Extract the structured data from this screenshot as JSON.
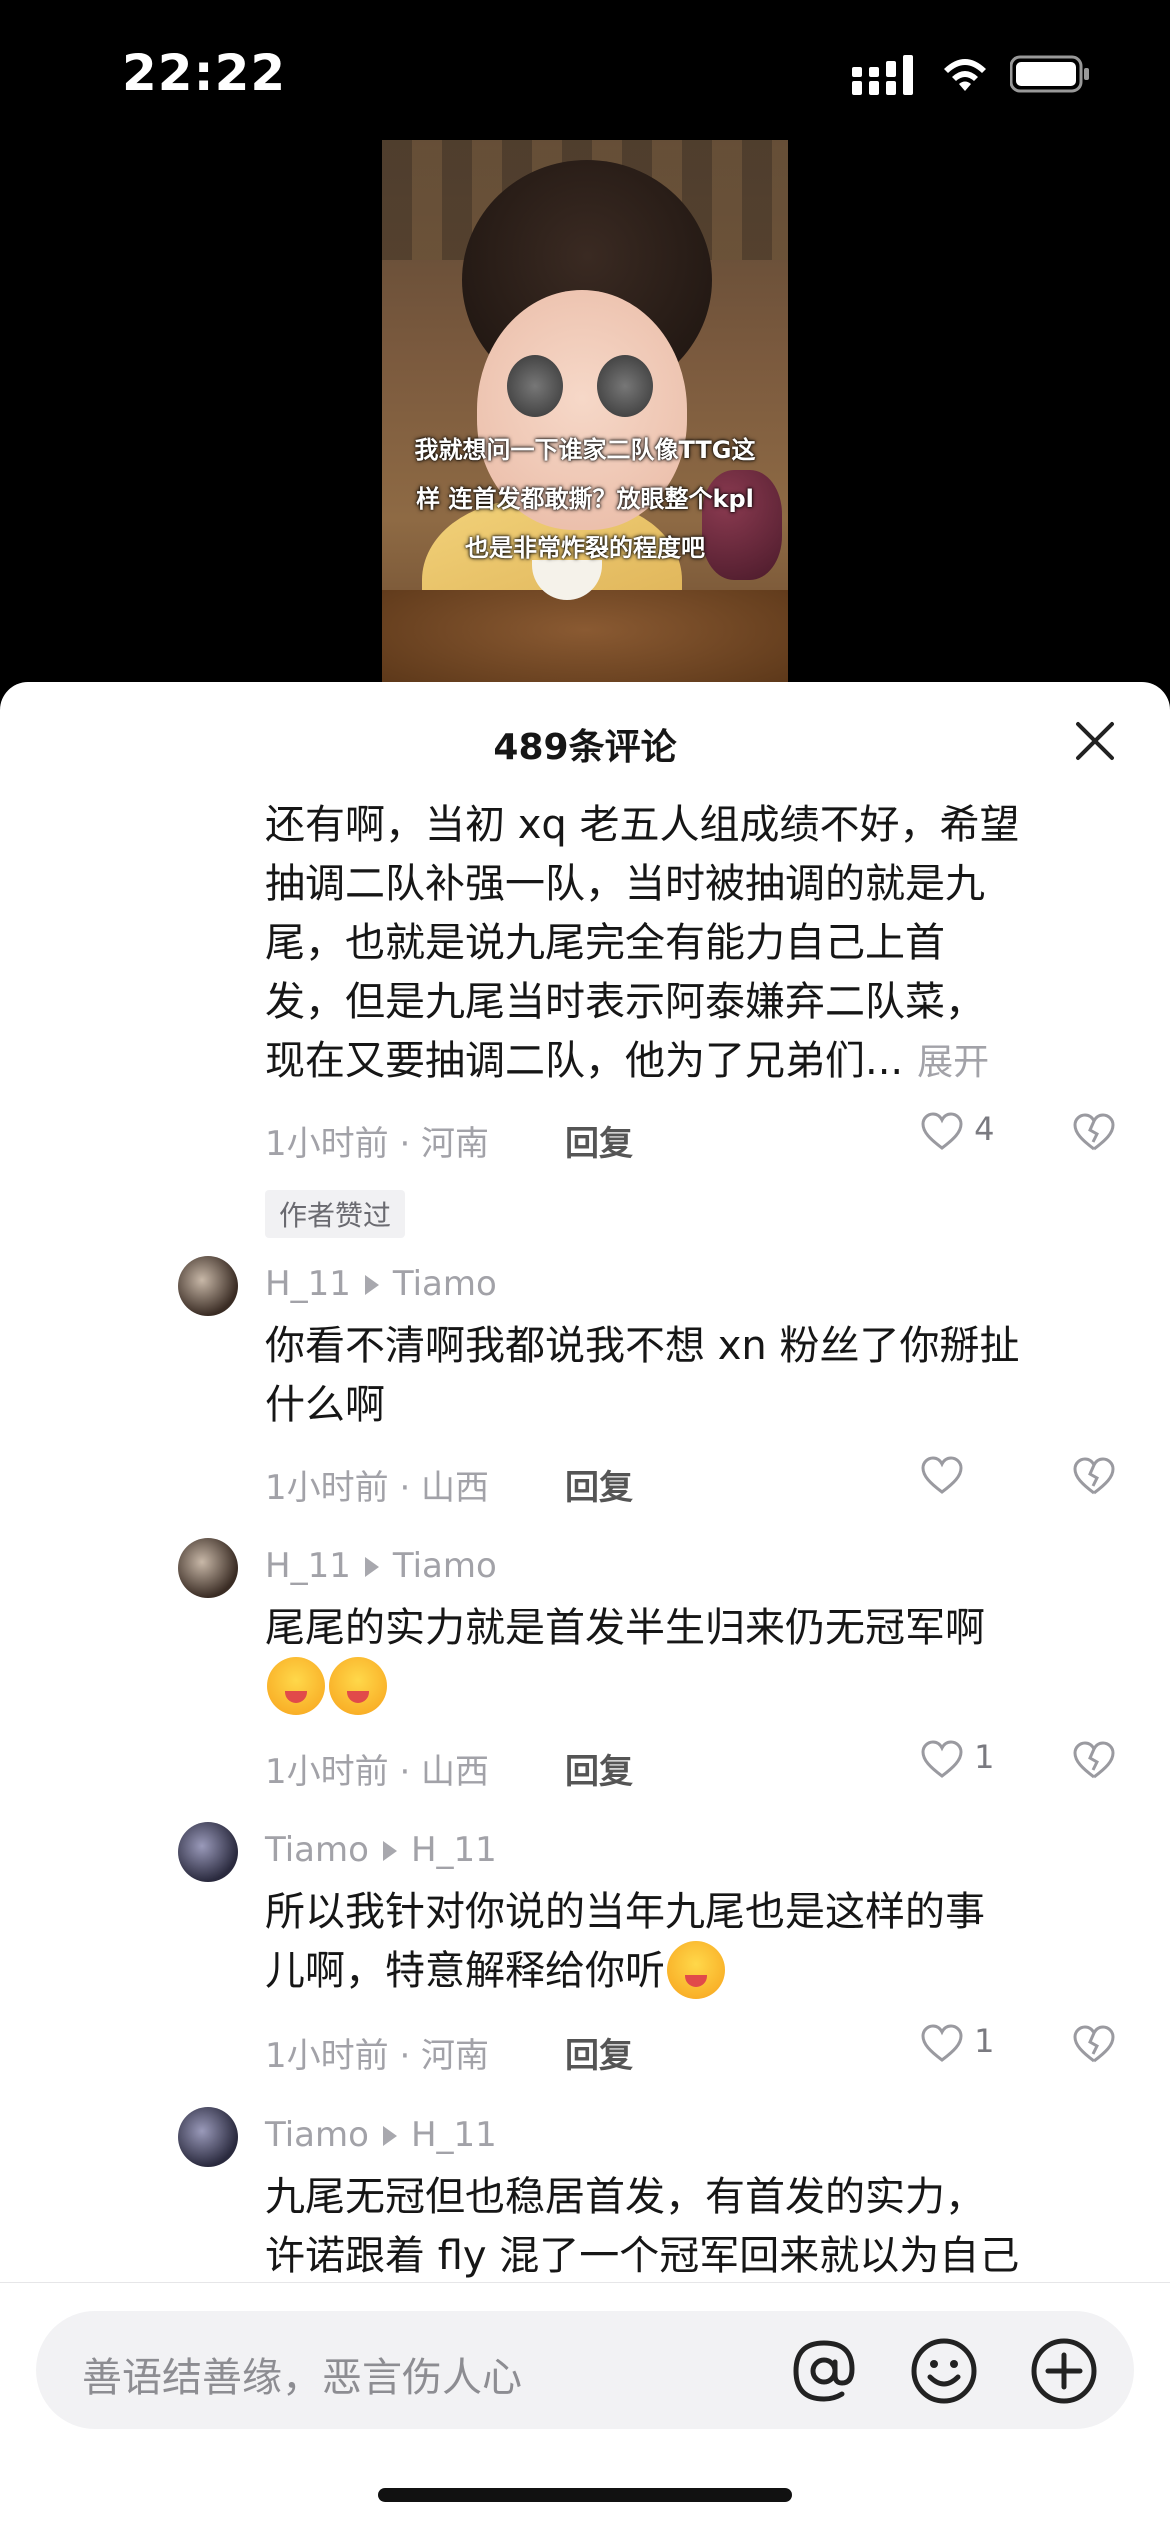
{
  "status": {
    "time": "22:22"
  },
  "video": {
    "caption_lines": [
      "我就想问一下谁家二队像TTG这",
      "样 连首发都敢撕？放眼整个kpl",
      "也是非常炸裂的程度吧"
    ]
  },
  "sheet": {
    "title": "489条评论"
  },
  "comments": [
    {
      "lines": [
        "还有啊，当初 xq 老五人组成绩不好，希望",
        "抽调二队补强一队，当时被抽调的就是九",
        "尾，也就是说九尾完全有能力自己上首",
        "发，但是九尾当时表示阿泰嫌弃二队菜，",
        "现在又要抽调二队，他为了兄弟们..."
      ],
      "expand": "展开",
      "meta": "1小时前 · 河南",
      "reply": "回复",
      "likes": "4",
      "badge": "作者赞过"
    },
    {
      "author": "H_11",
      "reply_to": "Tiamo",
      "lines": [
        "你看不清啊我都说我不想 xn 粉丝了你掰扯",
        "什么啊"
      ],
      "meta": "1小时前 · 山西",
      "reply": "回复",
      "likes": ""
    },
    {
      "author": "H_11",
      "reply_to": "Tiamo",
      "lines": [
        "尾尾的实力就是首发半生归来仍无冠军啊"
      ],
      "meta": "1小时前 · 山西",
      "reply": "回复",
      "likes": "1"
    },
    {
      "author": "Tiamo",
      "reply_to": "H_11",
      "lines": [
        "所以我针对你说的当年九尾也是这样的事",
        "儿啊，特意解释给你听"
      ],
      "meta": "1小时前 · 河南",
      "reply": "回复",
      "likes": "1"
    },
    {
      "author": "Tiamo",
      "reply_to": "H_11",
      "lines": [
        "九尾无冠但也稳居首发，有首发的实力，",
        "许诺跟着 fly 混了一个冠军回来就以为自己"
      ]
    }
  ],
  "input": {
    "placeholder": "善语结善缘，恶言伤人心"
  },
  "icons": {
    "mention": "at-icon",
    "emoji": "smiley-icon",
    "plus": "plus-icon",
    "like": "heart-icon",
    "dislike": "broken-heart-icon",
    "close": "close-icon"
  }
}
